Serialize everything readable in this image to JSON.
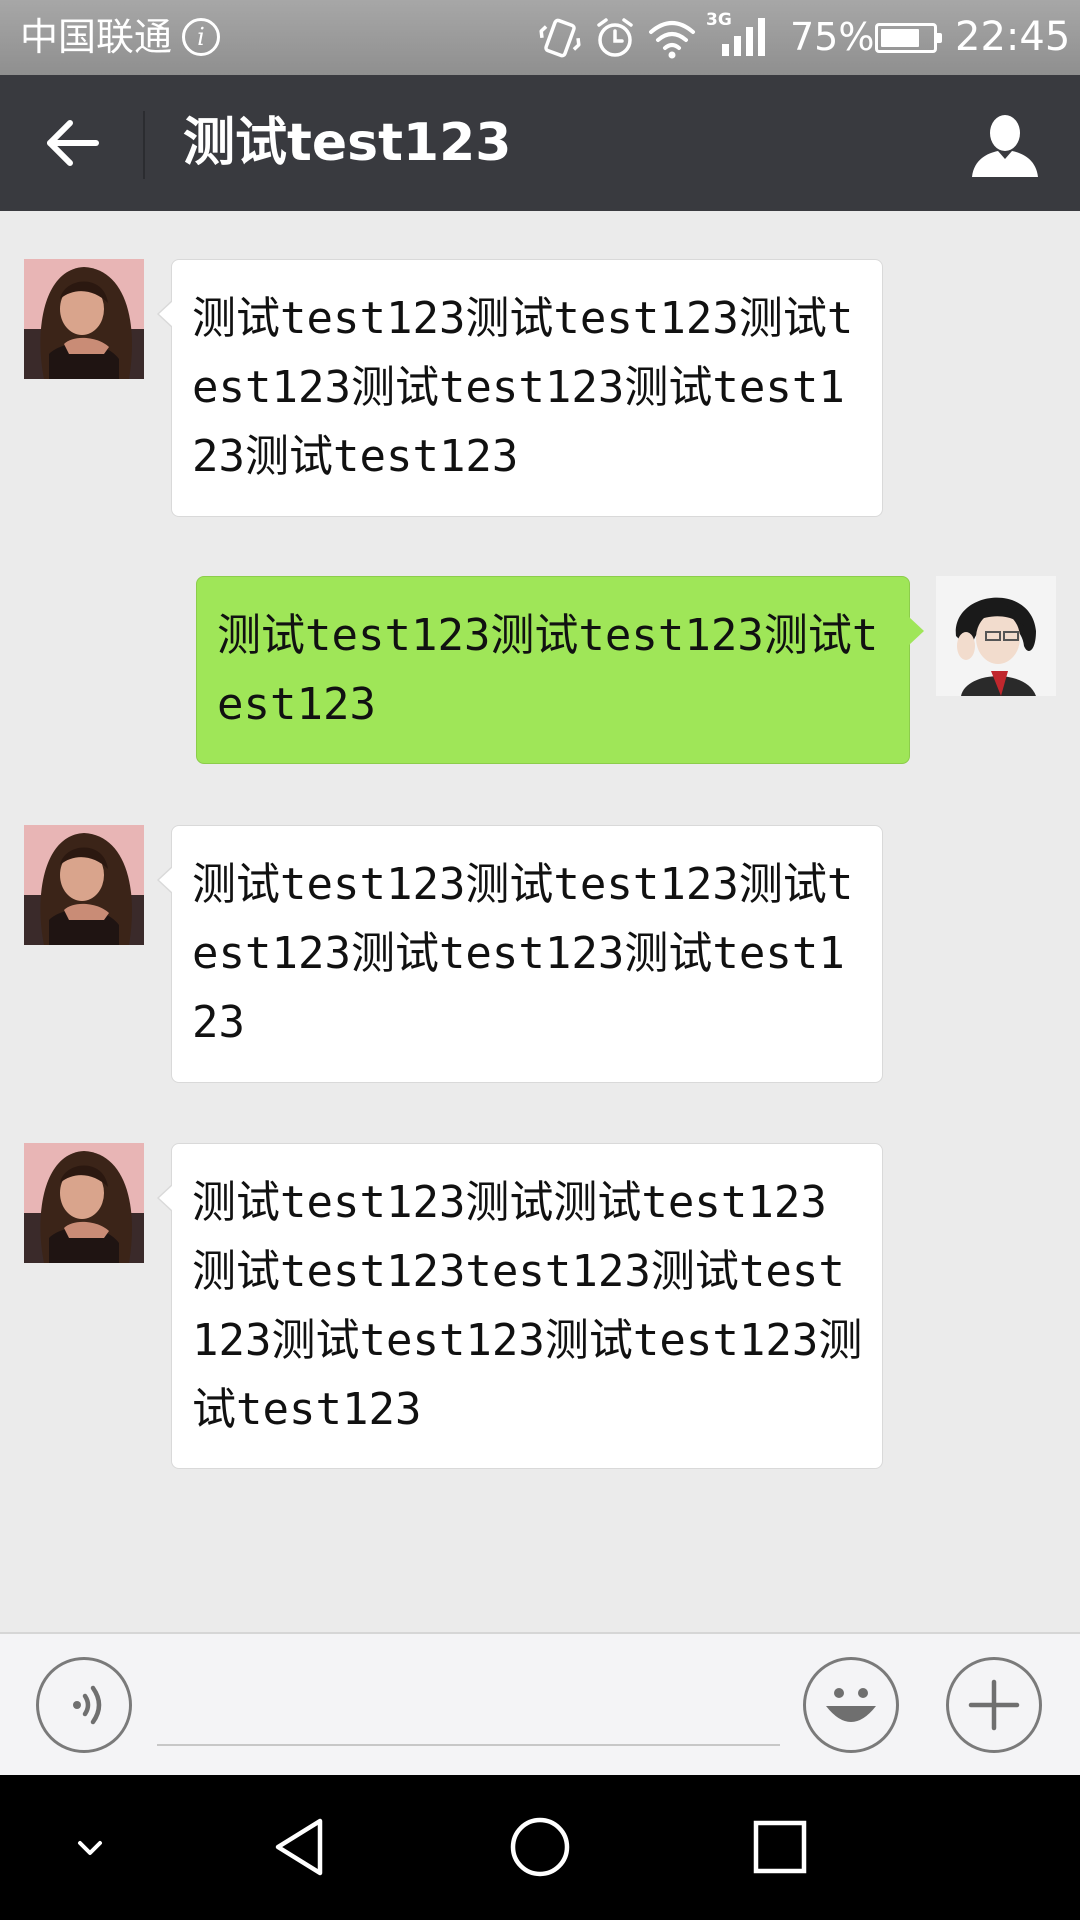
{
  "status_bar": {
    "carrier": "中国联通",
    "info_icon": "i",
    "icons": [
      "vibrate-icon",
      "alarm-icon",
      "wifi-icon",
      "signal-3g-icon"
    ],
    "network_label": "3G",
    "battery_percent": "75%",
    "battery_level": 0.75,
    "time": "22:45"
  },
  "header": {
    "title": "测试test123",
    "back_icon": "arrow-left-icon",
    "contact_icon": "person-icon"
  },
  "messages": [
    {
      "direction": "incoming",
      "sender": "contact",
      "text": "测试test123测试test123测试test123测试test123测试test123测试test123"
    },
    {
      "direction": "outgoing",
      "sender": "me",
      "text": "测试test123测试test123测试test123"
    },
    {
      "direction": "incoming",
      "sender": "contact",
      "text": "测试test123测试test123测试test123测试test123测试test123"
    },
    {
      "direction": "incoming",
      "sender": "contact",
      "text": "测试test123测试测试test123测试test123test123测试test123测试test123测试test123测试test123"
    }
  ],
  "input_bar": {
    "text_value": "",
    "placeholder": "",
    "voice_icon": "voice-icon",
    "emoji_icon": "smiley-icon",
    "more_icon": "plus-icon"
  },
  "nav_bar": {
    "icons": [
      "chevron-down-icon",
      "back-triangle-icon",
      "home-circle-icon",
      "recents-square-icon"
    ]
  },
  "colors": {
    "status_bar": "#9a9a9a",
    "title_bar": "#393a3f",
    "chat_background": "#ebebeb",
    "incoming_bubble": "#ffffff",
    "outgoing_bubble": "#9fe658",
    "nav_bar": "#000000"
  }
}
